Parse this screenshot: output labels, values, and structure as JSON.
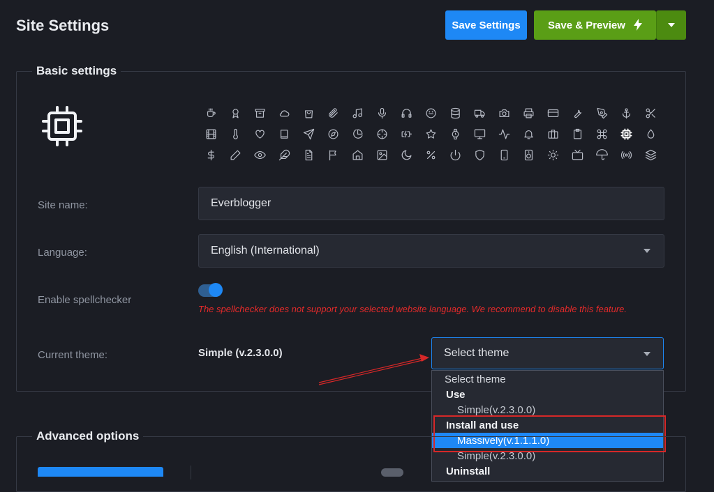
{
  "header": {
    "title": "Site Settings",
    "save_label": "Save Settings",
    "preview_label": "Save & Preview"
  },
  "basic": {
    "legend": "Basic settings",
    "site_name_label": "Site name:",
    "site_name_value": "Everblogger",
    "language_label": "Language:",
    "language_value": "English (International)",
    "spellcheck_label": "Enable spellchecker",
    "spellcheck_enabled": true,
    "spellcheck_warning": "The spellchecker does not support your selected website language. We recommend to disable this feature.",
    "theme_label": "Current theme:",
    "theme_current": "Simple (v.2.3.0.0)",
    "theme_select_value": "Select theme",
    "icons": [
      "coffee-icon",
      "award-icon",
      "archive-icon",
      "cloud-icon",
      "shopping-bag-icon",
      "paperclip-icon",
      "music-icon",
      "mic-icon",
      "headphones-icon",
      "smile-icon",
      "database-icon",
      "truck-icon",
      "camera-icon",
      "printer-icon",
      "credit-card-icon",
      "wrench-icon",
      "pen-tool-icon",
      "anchor-icon",
      "scissors-icon",
      "film-icon",
      "thermometer-icon",
      "heart-icon",
      "book-icon",
      "send-icon",
      "compass-icon",
      "pie-chart-icon",
      "crosshair-icon",
      "battery-charging-icon",
      "star-icon",
      "watch-icon",
      "monitor-icon",
      "activity-icon",
      "bell-icon",
      "briefcase-icon",
      "clipboard-icon",
      "command-icon",
      "cpu-icon",
      "droplet-icon",
      "dollar-icon",
      "pencil-icon",
      "eye-icon",
      "feather-icon",
      "file-text-icon",
      "flag-icon",
      "home-icon",
      "image-icon",
      "moon-icon",
      "percent-icon",
      "power-icon",
      "shield-icon",
      "smartphone-icon",
      "speaker-icon",
      "sun-icon",
      "tv-icon",
      "umbrella-icon",
      "radio-icon",
      "layers-icon"
    ],
    "selected_icon": "cpu-icon"
  },
  "theme_dropdown": {
    "placeholder": "Select theme",
    "group_use": "Use",
    "use_option": "Simple(v.2.3.0.0)",
    "group_install": "Install and use",
    "install_option_1": "Massively(v.1.1.1.0)",
    "install_option_2": "Simple(v.2.3.0.0)",
    "group_uninstall": "Uninstall",
    "selected": "Massively(v.1.1.1.0)"
  },
  "advanced": {
    "legend": "Advanced options"
  },
  "colors": {
    "background": "#1b1d24",
    "accent": "#1e88f5",
    "success": "#5a9e16",
    "warning_text": "#e52a2a"
  }
}
